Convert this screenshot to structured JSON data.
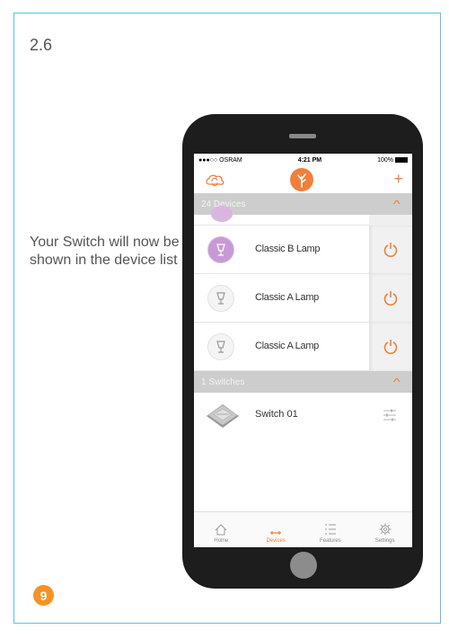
{
  "step": {
    "number": "2.6"
  },
  "caption": {
    "text": "Your Switch will now be shown in the device list"
  },
  "page_badge": "9",
  "colors": {
    "frame": "#56c3e6",
    "accent": "#f07f3c",
    "badge": "#f39325"
  },
  "phone": {
    "status_bar": {
      "carrier": "●●●○○ OSRAM",
      "time": "4:21 PM",
      "battery": "100%"
    },
    "app_bar": {
      "left_icon": "cloud-sync-icon",
      "center_icon": "lightify-logo-icon",
      "right_icon": "plus-icon"
    },
    "devices_section": {
      "title": "24 Devices"
    },
    "devices": [
      {
        "name": "Classic B Lamp",
        "state": "on"
      },
      {
        "name": "Classic A Lamp",
        "state": "off"
      },
      {
        "name": "Classic A Lamp",
        "state": "off"
      }
    ],
    "switches_section": {
      "title": "1  Switches"
    },
    "switches": [
      {
        "name": "Switch 01"
      }
    ],
    "tabs": [
      {
        "label": "Home",
        "icon": "house-icon",
        "active": false
      },
      {
        "label": "Devices",
        "icon": "devices-icon",
        "active": true
      },
      {
        "label": "Features",
        "icon": "list-icon",
        "active": false
      },
      {
        "label": "Settings",
        "icon": "gear-icon",
        "active": false
      }
    ]
  }
}
